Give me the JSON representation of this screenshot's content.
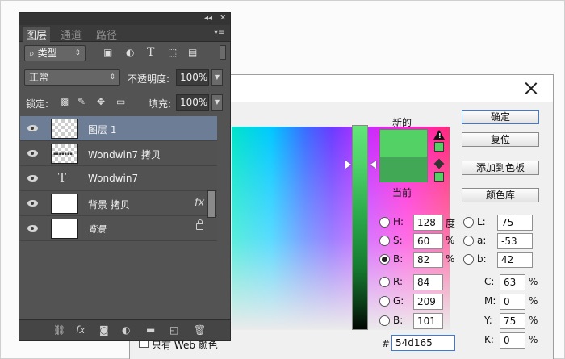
{
  "dialog": {
    "new_label": "新的",
    "current_label": "当前",
    "buttons": {
      "ok": "确定",
      "reset": "复位",
      "add_to_swatches": "添加到色板",
      "color_libraries": "颜色库"
    },
    "hsb": {
      "h_label": "H:",
      "h_value": "128",
      "h_unit": "度",
      "s_label": "S:",
      "s_value": "60",
      "s_unit": "%",
      "b_label": "B:",
      "b_value": "82",
      "b_unit": "%"
    },
    "lab": {
      "l_label": "L:",
      "l_value": "75",
      "a_label": "a:",
      "a_value": "-53",
      "b_label": "b:",
      "b_value": "42"
    },
    "rgb": {
      "r_label": "R:",
      "r_value": "84",
      "g_label": "G:",
      "g_value": "209",
      "b_label": "B:",
      "b_value": "101"
    },
    "cmyk": {
      "c_label": "C:",
      "c_value": "63",
      "m_label": "M:",
      "m_value": "0",
      "y_label": "Y:",
      "y_value": "75",
      "k_label": "K:",
      "k_value": "0",
      "unit": "%"
    },
    "hex_label": "#",
    "hex_value": "54d165",
    "web_only_label": "只有 Web 颜色",
    "selected_mode": "B",
    "new_color": "#54d165",
    "current_color": "#41a955"
  },
  "layers_panel": {
    "collapse_glyph": "◂◂",
    "close_glyph": "✕",
    "tabs": [
      "图层",
      "通道",
      "路径"
    ],
    "active_tab": "图层",
    "filter_kind": "类型",
    "blend_mode": "正常",
    "opacity_label": "不透明度:",
    "opacity_value": "100%",
    "lock_label": "锁定:",
    "fill_label": "填充:",
    "fill_value": "100%",
    "layers": [
      {
        "name": "图层 1",
        "thumb": "checker",
        "selected": true
      },
      {
        "name": "Wondwin7 拷贝",
        "thumb": "checker-text"
      },
      {
        "name": "Wondwin7",
        "thumb": "type"
      },
      {
        "name": "背景 拷贝",
        "thumb": "white",
        "fx": "fx"
      },
      {
        "name": "背景",
        "thumb": "white",
        "locked": true
      }
    ],
    "bottom_icons": [
      "link-icon",
      "fx-icon",
      "mask-icon",
      "adjustment-icon",
      "folder-icon",
      "new-layer-icon",
      "trash-icon"
    ],
    "fx_glyph": "fx"
  }
}
